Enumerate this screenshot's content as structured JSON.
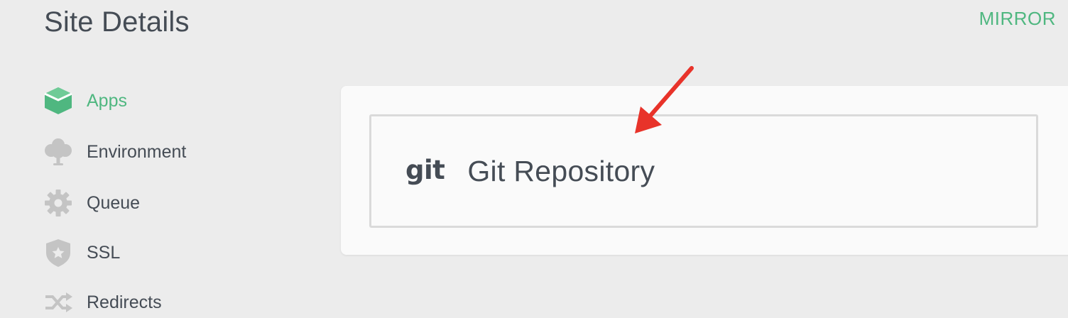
{
  "header": {
    "title": "Site Details",
    "mirror_label": "MIRROR"
  },
  "sidebar": {
    "items": [
      {
        "label": "Apps",
        "icon": "cube-icon",
        "active": true
      },
      {
        "label": "Environment",
        "icon": "tree-icon",
        "active": false
      },
      {
        "label": "Queue",
        "icon": "gear-icon",
        "active": false
      },
      {
        "label": "SSL",
        "icon": "shield-icon",
        "active": false
      },
      {
        "label": "Redirects",
        "icon": "shuffle-icon",
        "active": false
      }
    ]
  },
  "main": {
    "repo_option": {
      "logo_text": "git",
      "label": "Git Repository"
    }
  },
  "colors": {
    "accent": "#4fb780",
    "text": "#454c55",
    "icon_gray": "#c4c4c4",
    "arrow": "#e8332a",
    "background": "#ececec",
    "card": "#fafafa"
  }
}
